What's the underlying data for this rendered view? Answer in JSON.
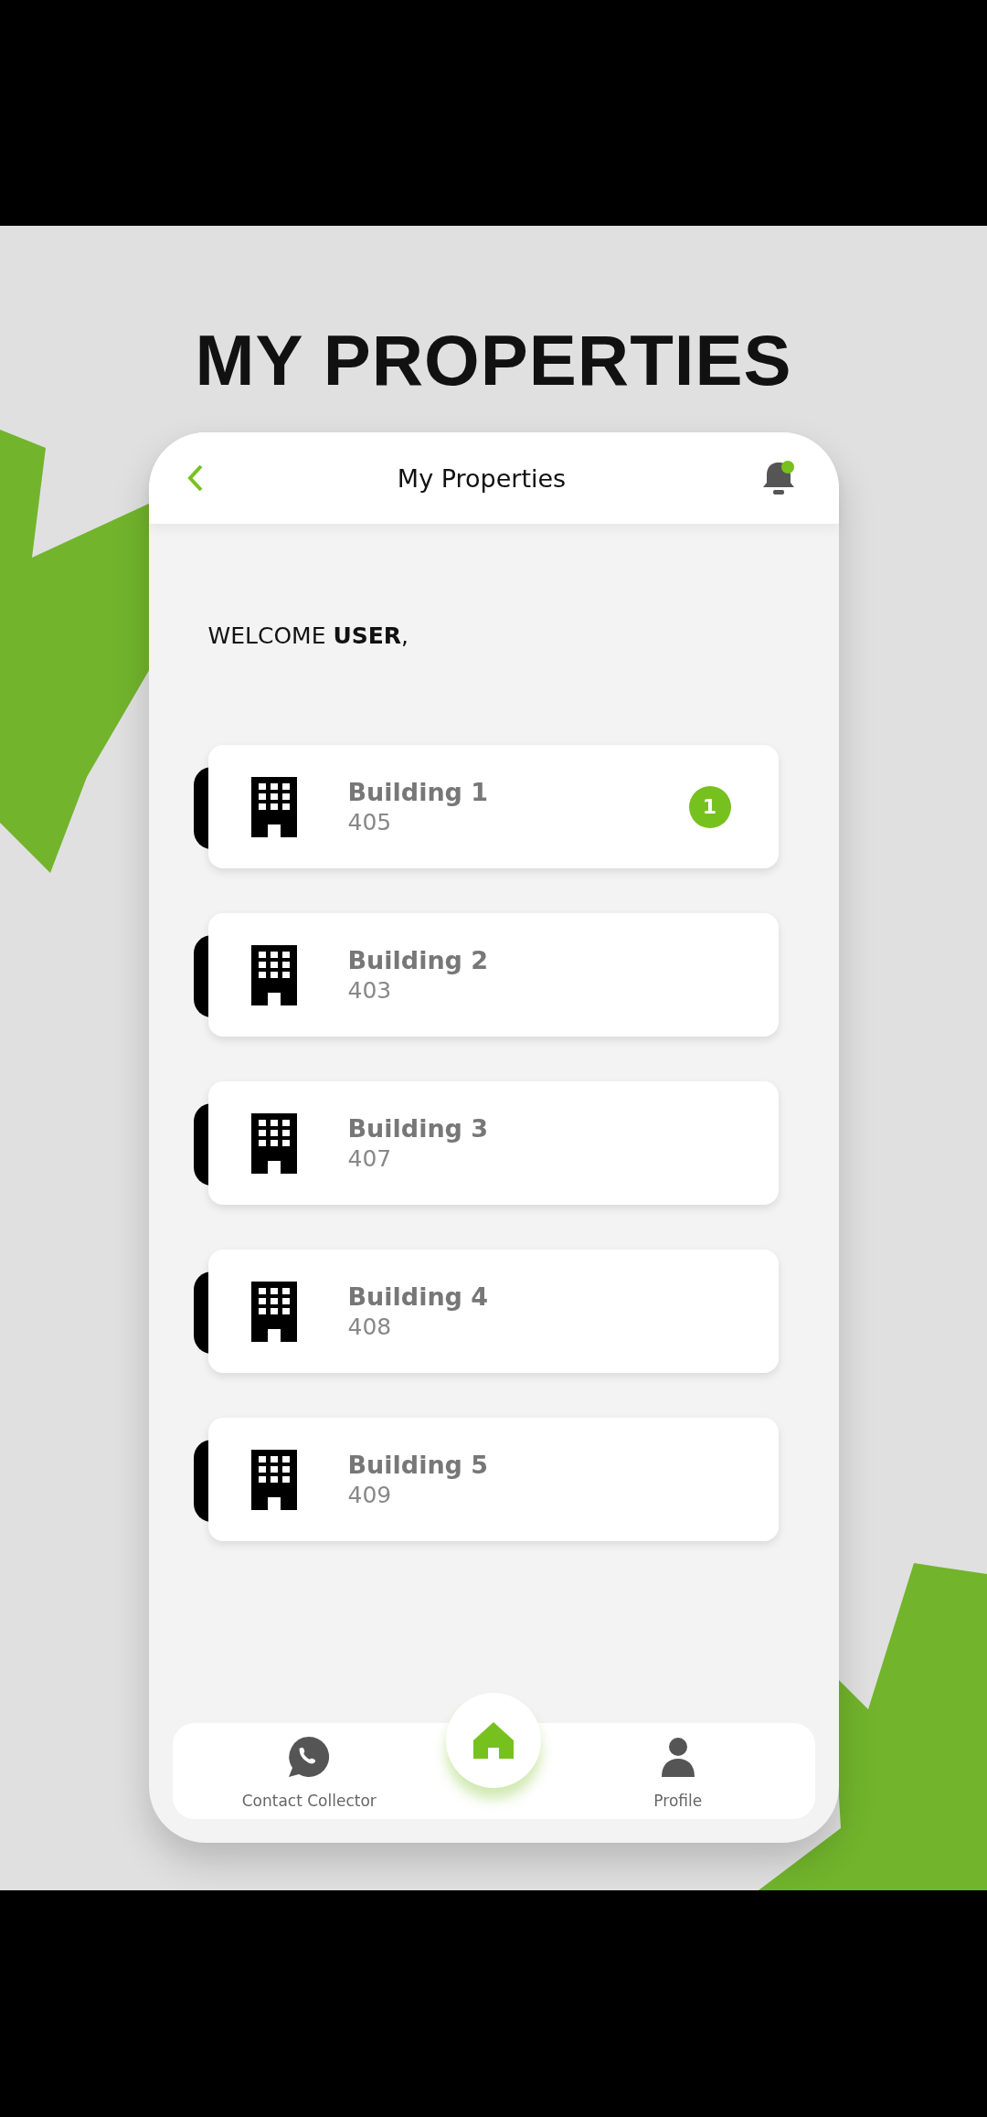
{
  "heading": "MY PROPERTIES",
  "app_bar": {
    "title": "My Properties",
    "bell_unread": true
  },
  "welcome": "WELCOME **USER**,",
  "buildings": [
    {
      "name": "Building 1",
      "number": "405",
      "badge": "1"
    },
    {
      "name": "Building 2",
      "number": "403"
    },
    {
      "name": "Building 3",
      "number": "407"
    },
    {
      "name": "Building 4",
      "number": "408"
    },
    {
      "name": "Building 5",
      "number": "409"
    }
  ],
  "nav": [
    {
      "kind": "chat",
      "label": "Contact Collector",
      "selected": false
    },
    {
      "kind": "home",
      "selected": true
    },
    {
      "kind": "person",
      "label": "Profile",
      "selected": false
    }
  ]
}
